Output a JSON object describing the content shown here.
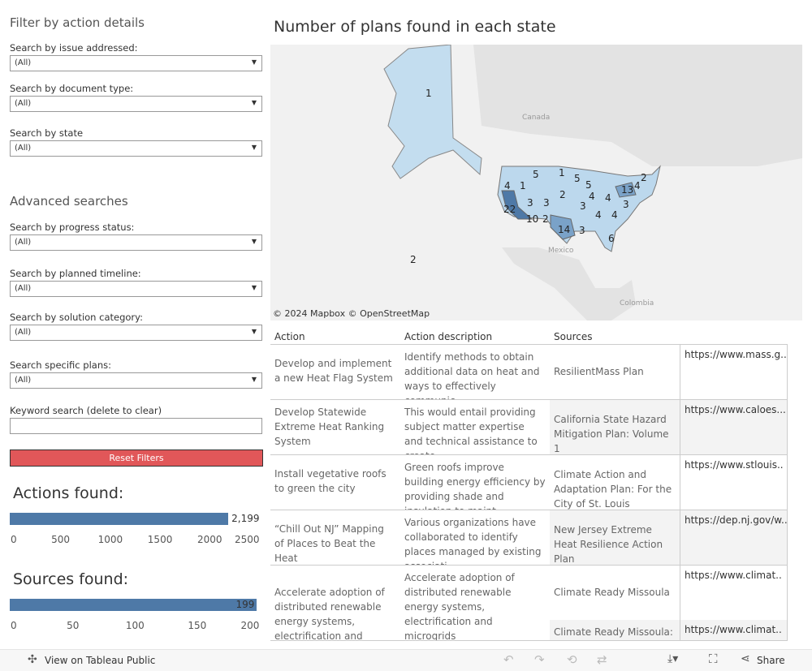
{
  "filters": {
    "heading": "Filter by action details",
    "issue": {
      "label": "Search by issue addressed:",
      "value": "(All)"
    },
    "doctype": {
      "label": "Search by document type:",
      "value": "(All)"
    },
    "state": {
      "label": "Search by state",
      "value": "(All)"
    },
    "advanced_heading": "Advanced searches",
    "progress": {
      "label": "Search by progress status:",
      "value": "(All)"
    },
    "timeline": {
      "label": "Search by planned timeline:",
      "value": "(All)"
    },
    "solution": {
      "label": "Search by solution category:",
      "value": "(All)"
    },
    "plans": {
      "label": "Search specific plans:",
      "value": "(All)"
    },
    "keyword": {
      "label": "Keyword search (delete to clear)",
      "value": ""
    },
    "reset": "Reset Filters"
  },
  "actions_found": {
    "title": "Actions found:",
    "value": 2199,
    "value_label": "2,199",
    "max": 2500,
    "ticks": [
      "0",
      "500",
      "1000",
      "1500",
      "2000",
      "2500"
    ],
    "color": "#4e79a7"
  },
  "sources_found": {
    "title": "Sources found:",
    "value": 199,
    "value_label": "199",
    "max": 200,
    "ticks": [
      "0",
      "50",
      "100",
      "150",
      "200"
    ],
    "color": "#4e79a7"
  },
  "map": {
    "title": "Number of plans found in each state",
    "attribution": "© 2024 Mapbox  © OpenStreetMap",
    "place_labels": {
      "canada": "Canada",
      "mexico": "Mexico",
      "colombia": "Colombia"
    },
    "states": [
      {
        "state": "AK",
        "value": "1"
      },
      {
        "state": "MT",
        "value": "5"
      },
      {
        "state": "ND",
        "value": "1"
      },
      {
        "state": "MN",
        "value": "5"
      },
      {
        "state": "OR",
        "value": "4"
      },
      {
        "state": "ID",
        "value": "1"
      },
      {
        "state": "WI",
        "value": "5"
      },
      {
        "state": "NE",
        "value": "2"
      },
      {
        "state": "UT",
        "value": "3"
      },
      {
        "state": "CO",
        "value": "3"
      },
      {
        "state": "MO",
        "value": "3"
      },
      {
        "state": "IL",
        "value": "4"
      },
      {
        "state": "OH",
        "value": "4"
      },
      {
        "state": "NY",
        "value": "13"
      },
      {
        "state": "MA",
        "value": "4"
      },
      {
        "state": "ME",
        "value": "2"
      },
      {
        "state": "NJ",
        "value": "3"
      },
      {
        "state": "CA",
        "value": "22"
      },
      {
        "state": "AZ",
        "value": "10"
      },
      {
        "state": "NM",
        "value": "2"
      },
      {
        "state": "TX",
        "value": "14"
      },
      {
        "state": "LA",
        "value": "3"
      },
      {
        "state": "FL",
        "value": "6"
      },
      {
        "state": "AL",
        "value": "4"
      },
      {
        "state": "NC",
        "value": "4"
      },
      {
        "state": "HI",
        "value": "2"
      }
    ]
  },
  "table": {
    "headers": [
      "Action",
      "Action description",
      "Sources"
    ],
    "rows": [
      {
        "action": " Develop and implement a new Heat Flag System",
        "desc": "Identify methods to obtain additional data on heat and ways to effectively communic..",
        "sources": [
          {
            "name": "ResilientMass Plan",
            "url": "https://www.mass.g.."
          }
        ]
      },
      {
        "action": " Develop Statewide Extreme Heat Ranking System",
        "desc": "This would entail providing subject matter expertise and technical assistance to create ..",
        "sources": [
          {
            "name": "California State Hazard Mitigation Plan: Volume 1",
            "url": "https://www.caloes..."
          }
        ]
      },
      {
        "action": "Install vegetative roofs to green the city",
        "desc": "Green roofs improve building energy efficiency by providing shade and insulation to maint..",
        "sources": [
          {
            "name": "Climate Action and Adaptation Plan: For the City of St. Louis Sustainab..",
            "url": "https://www.stlouis.."
          }
        ]
      },
      {
        "action": "“Chill Out NJ” Mapping of Places to Beat the Heat",
        "desc": "Various organizations have collaborated to identify places managed by existing associati..",
        "sources": [
          {
            "name": "New Jersey Extreme Heat Resilience Action Plan",
            "url": "https://dep.nj.gov/w.."
          }
        ]
      },
      {
        "action": "Accelerate adoption of distributed renewable energy systems, electrification and",
        "desc": "Accelerate adoption of distributed renewable energy systems, electrification and microgrids",
        "sources": [
          {
            "name": "Climate Ready Missoula",
            "url": "https://www.climat.."
          },
          {
            "name": "Climate Ready Missoula:",
            "url": "https://www.climat.."
          }
        ]
      }
    ]
  },
  "footer": {
    "view": "View on Tableau Public",
    "share": "Share"
  }
}
